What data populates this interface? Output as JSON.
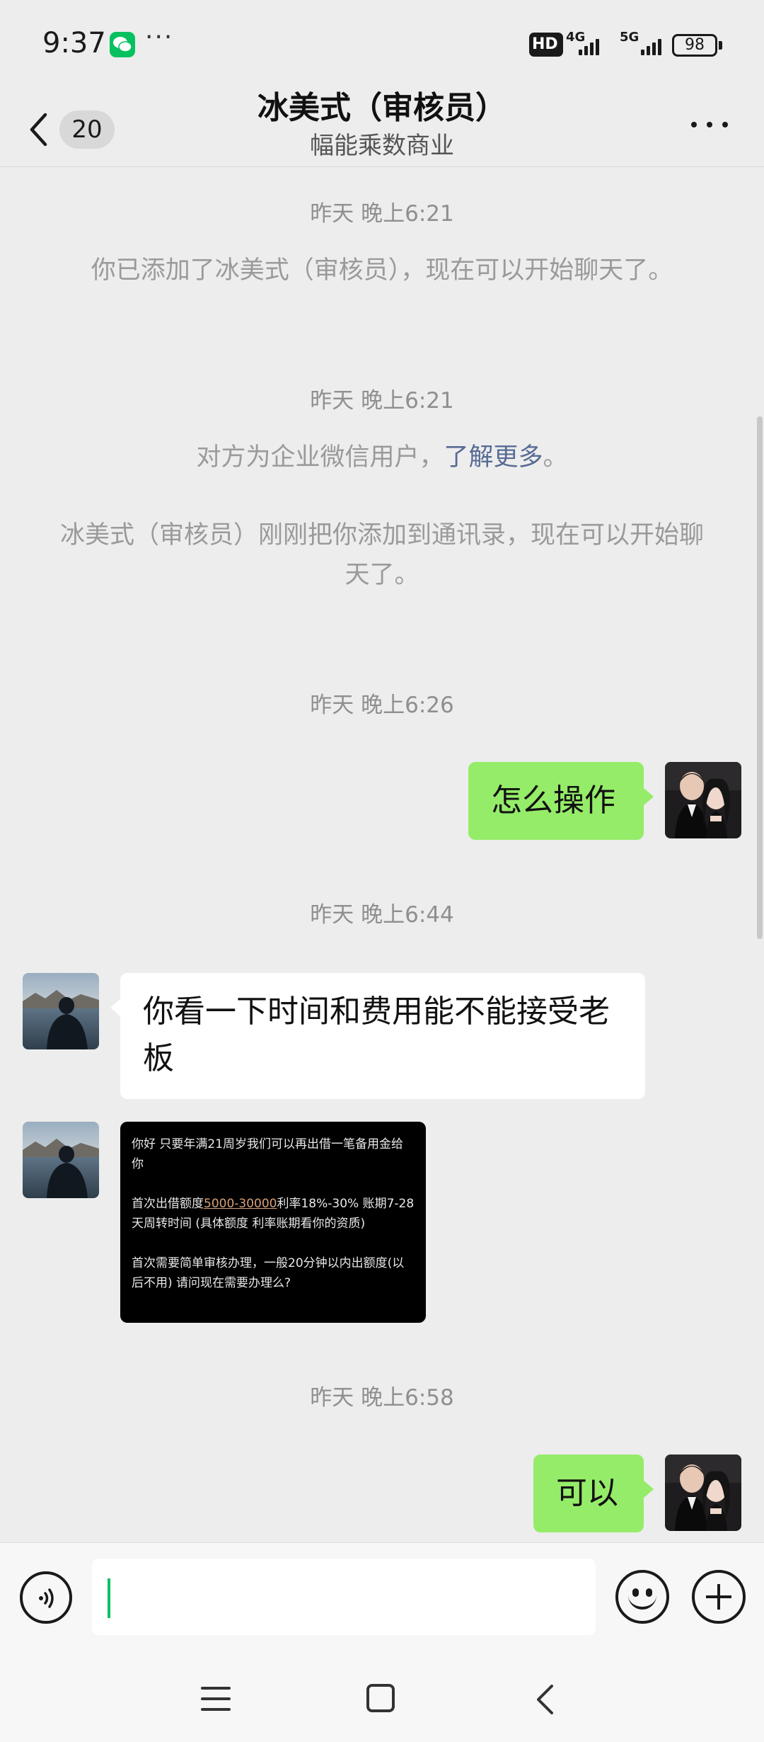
{
  "status_bar": {
    "time": "9:37",
    "notification_app": "wechat-icon",
    "more": "···",
    "hd_label": "HD",
    "network_1": "4G",
    "network_2": "5G",
    "battery": "98"
  },
  "header": {
    "unread_count": "20",
    "title": "冰美式（审核员）",
    "subtitle": "幅能乘数商业"
  },
  "messages": [
    {
      "type": "timestamp",
      "text": "昨天 晚上6:21"
    },
    {
      "type": "system",
      "text": "你已添加了冰美式（审核员），现在可以开始聊天了。"
    },
    {
      "type": "timestamp",
      "text": "昨天 晚上6:21"
    },
    {
      "type": "system",
      "text_before": "对方为企业微信用户，",
      "link": "了解更多",
      "text_after": "。"
    },
    {
      "type": "system",
      "text": "冰美式（审核员）刚刚把你添加到通讯录，现在可以开始聊天了。"
    },
    {
      "type": "timestamp",
      "text": "昨天 晚上6:26"
    },
    {
      "type": "outgoing",
      "text": "怎么操作"
    },
    {
      "type": "timestamp",
      "text": "昨天 晚上6:44"
    },
    {
      "type": "incoming",
      "text": "你看一下时间和费用能不能接受老板"
    },
    {
      "type": "incoming_image",
      "line1": "你好 只要年满21周岁我们可以再出借一笔备用金给你",
      "line2_before": "首次出借额度",
      "line2_highlight": "5000-30000",
      "line2_after": "利率18%-30% 账期7-28天周转时间 (具体额度 利率账期看你的资质)",
      "line3": "首次需要简单审核办理，一般20分钟以内出额度(以后不用) 请问现在需要办理么?"
    },
    {
      "type": "timestamp",
      "text": "昨天 晚上6:58"
    },
    {
      "type": "outgoing",
      "text": "可以"
    }
  ],
  "input_bar": {
    "voice_icon": "voice-icon",
    "input_value": "",
    "emoji_icon": "emoji-icon",
    "plus_icon": "plus-icon"
  },
  "colors": {
    "outgoing_bubble": "#95ec69",
    "incoming_bubble": "#ffffff",
    "background": "#ededed",
    "link": "#576b95",
    "caret": "#07c160"
  }
}
